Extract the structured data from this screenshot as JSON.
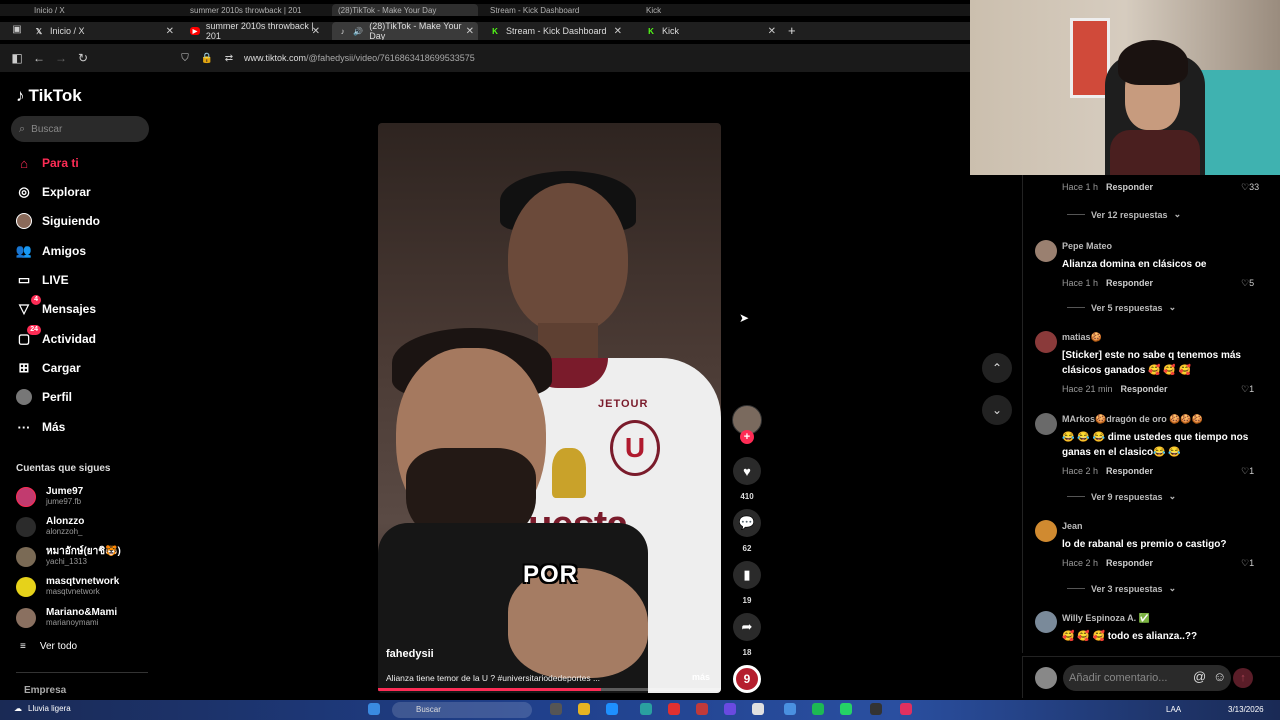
{
  "browser": {
    "tabs": [
      {
        "label": "Inicio / X",
        "icon": "x-logo-icon"
      },
      {
        "label": "summer 2010s throwback | 201",
        "icon": "youtube-icon"
      },
      {
        "label": "(28)TikTok - Make Your Day",
        "icon": "tiktok-icon"
      },
      {
        "label": "Stream - Kick Dashboard",
        "icon": "kick-icon"
      },
      {
        "label": "Kick",
        "icon": "kick-icon"
      }
    ],
    "tabs_top": [
      {
        "label": "Inicio / X"
      },
      {
        "label": "summer 2010s throwback | 201"
      },
      {
        "label": "(28)TikTok - Make Your Day"
      },
      {
        "label": "Stream - Kick Dashboard"
      },
      {
        "label": "Kick"
      }
    ],
    "url_host": "www.tiktok.com",
    "url_path": "/@fahedysii/video/7616863418699533575",
    "new_tab": "+"
  },
  "sidebar": {
    "logo": "TikTok",
    "search_placeholder": "Buscar",
    "nav": [
      {
        "label": "Para ti",
        "icon": "home-icon",
        "active": true
      },
      {
        "label": "Explorar",
        "icon": "compass-icon"
      },
      {
        "label": "Siguiendo",
        "icon": "following-avatar-icon"
      },
      {
        "label": "Amigos",
        "icon": "friends-icon"
      },
      {
        "label": "LIVE",
        "icon": "live-icon"
      },
      {
        "label": "Mensajes",
        "icon": "inbox-icon",
        "badge": "4"
      },
      {
        "label": "Actividad",
        "icon": "activity-icon",
        "badge": "24"
      },
      {
        "label": "Cargar",
        "icon": "upload-icon"
      },
      {
        "label": "Perfil",
        "icon": "profile-avatar-icon"
      },
      {
        "label": "Más",
        "icon": "more-icon"
      }
    ],
    "following_title": "Cuentas que sigues",
    "following": [
      {
        "name": "Jume97",
        "handle": "jume97.fb",
        "color": "#c23b6f"
      },
      {
        "name": "Alonzzo",
        "handle": "alonzzoh_",
        "color": "#2b2b2b"
      },
      {
        "name": "หมาอักษ์(ยาชิ🐯)",
        "handle": "yachi_1313",
        "color": "#7a6a55"
      },
      {
        "name": "masqtvnetwork",
        "handle": "masqtvnetwork",
        "color": "#e6d21a"
      },
      {
        "name": "Mariano&Mami",
        "handle": "marianoymami",
        "color": "#8a7060"
      }
    ],
    "see_all": "Ver todo",
    "footer": "Empresa"
  },
  "video": {
    "caption_word": "POR",
    "username": "fahedysii",
    "description": "Alianza tiene temor de la U ? #universitariodedeportes ...",
    "more": "más",
    "progress": 0.65,
    "likes": "410",
    "comments": "62",
    "saves": "19",
    "shares": "18"
  },
  "comments": [
    {
      "meta_time": "Hace 1 h",
      "reply": "Responder",
      "likes": "33",
      "replies": "Ver 12 respuestas"
    },
    {
      "name": "Pepe Mateo",
      "text": "Alianza domina en clásicos oe",
      "meta_time": "Hace 1 h",
      "reply": "Responder",
      "likes": "5",
      "replies": "Ver 5 respuestas",
      "color": "#9a8070"
    },
    {
      "name": "matias🍪",
      "text": "[Sticker] este no sabe q tenemos más clásicos ganados 🥰 🥰 🥰",
      "meta_time": "Hace 21 min",
      "reply": "Responder",
      "likes": "1",
      "color": "#8a3a3a"
    },
    {
      "name": "MArkos🍪dragón de oro 🍪🍪🍪",
      "text": "😂 😂 😂 dime ustedes que tiempo nos ganas en el clasico😂 😂",
      "meta_time": "Hace 2 h",
      "reply": "Responder",
      "likes": "1",
      "replies": "Ver 9 respuestas",
      "color": "#6a6a6a"
    },
    {
      "name": "Jean",
      "text": "lo de rabanal es premio o castigo?",
      "meta_time": "Hace 2 h",
      "reply": "Responder",
      "likes": "1",
      "replies": "Ver 3 respuestas",
      "color": "#d08a30"
    },
    {
      "name": "Willy Espinoza A. ✅",
      "text": "🥰 🥰 🥰 todo es alianza..??",
      "color": "#7a8a9a"
    }
  ],
  "comment_box": {
    "placeholder": "Añadir comentario..."
  },
  "taskbar": {
    "weather": "Lluvia ligera",
    "search": "Buscar",
    "lang": "LAA",
    "date": "3/13/2026"
  },
  "colors": {
    "accent": "#fe2c55",
    "kick": "#53fc18",
    "youtube": "#ff0000"
  }
}
